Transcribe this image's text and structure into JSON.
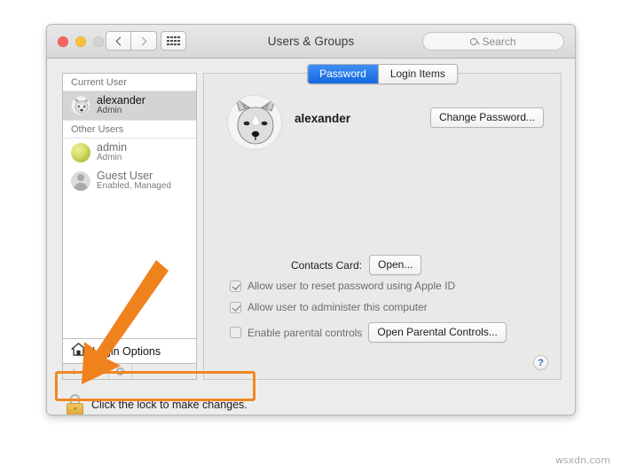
{
  "window": {
    "title": "Users & Groups",
    "traffic_lights": [
      "close",
      "minimize",
      "zoom"
    ],
    "nav": {
      "back": "back-chevron",
      "forward": "forward-chevron",
      "grid": "show-all-grid"
    },
    "search": {
      "placeholder": "Search",
      "value": "",
      "icon": "search-icon"
    }
  },
  "sidebar": {
    "group_current": "Current User",
    "group_other": "Other Users",
    "current_user": {
      "name": "alexander",
      "role": "Admin",
      "avatar": "fox-avatar",
      "selected": true
    },
    "other_users": [
      {
        "name": "admin",
        "role": "Admin",
        "avatar": "green-ball-avatar"
      },
      {
        "name": "Guest User",
        "role": "Enabled, Managed",
        "avatar": "guest-silhouette-avatar"
      }
    ],
    "login_options": {
      "label": "Login Options",
      "icon": "home-icon"
    },
    "toolbar": {
      "add": "+",
      "remove": "−",
      "gear": "⚙"
    }
  },
  "main": {
    "tabs": [
      {
        "label": "Password",
        "active": true
      },
      {
        "label": "Login Items",
        "active": false
      }
    ],
    "account_name": "alexander",
    "avatar": "fox-avatar",
    "change_password_button": "Change Password...",
    "contacts_card_label": "Contacts Card:",
    "contacts_open_button": "Open...",
    "checkboxes": [
      {
        "label": "Allow user to reset password using Apple ID",
        "checked": true
      },
      {
        "label": "Allow user to administer this computer",
        "checked": true
      },
      {
        "label": "Enable parental controls",
        "checked": false
      }
    ],
    "parental_controls_button": "Open Parental Controls...",
    "help_button": "?"
  },
  "footer": {
    "lock_text": "Click the lock to make changes.",
    "lock_icon": "closed-lock-icon",
    "lock_state": "locked"
  },
  "annotations": {
    "highlight_color": "#f08722",
    "arrow_color": "#f0821e",
    "arrow_points_to": "lock-button"
  },
  "watermark": "wsxdn.com"
}
